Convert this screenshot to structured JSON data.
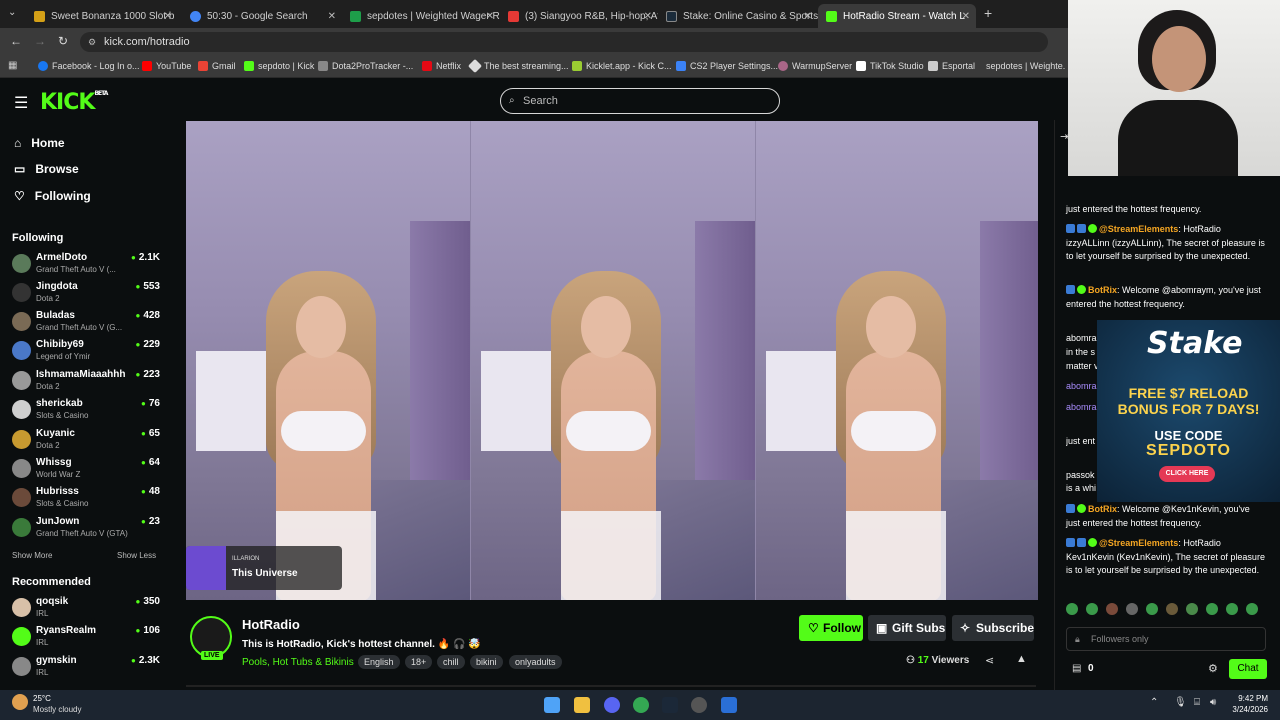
{
  "browser": {
    "tabs": [
      {
        "label": "Sweet Bonanza 1000 Slot b",
        "color": "#d4a017"
      },
      {
        "label": "50:30 - Google Search",
        "color": "#4285f4"
      },
      {
        "label": "sepdotes | Weighted Wager Ra",
        "color": "#1e9e4a"
      },
      {
        "label": "(3) Siangyoo R&B, Hip-hop, Afr",
        "color": "#e53935"
      },
      {
        "label": "Stake: Online Casino & Sports",
        "color": "#1b2b3a"
      },
      {
        "label": "HotRadio Stream - Watch L",
        "color": "#53fc18"
      }
    ],
    "url": "kick.com/hotradio",
    "bookmarks": [
      {
        "label": "Facebook - Log In o...",
        "color": "#1877f2"
      },
      {
        "label": "YouTube",
        "color": "#ff0000"
      },
      {
        "label": "Gmail",
        "color": "#ea4335"
      },
      {
        "label": "sepdoto | Kick",
        "color": "#53fc18"
      },
      {
        "label": "Dota2ProTracker -...",
        "color": "#888888"
      },
      {
        "label": "Netflix",
        "color": "#e50914"
      },
      {
        "label": "The best streaming...",
        "color": "#dddddd"
      },
      {
        "label": "Kicklet.app - Kick C...",
        "color": "#9acd32"
      },
      {
        "label": "CS2 Player Settings...",
        "color": "#3b82f6"
      },
      {
        "label": "WarmupServer",
        "color": "#aa6688"
      },
      {
        "label": "TikTok Studio",
        "color": "#ffffff"
      },
      {
        "label": "Esportal",
        "color": "#cccccc"
      },
      {
        "label": "sepdotes | Weighte...",
        "color": "#1e9e4a"
      }
    ]
  },
  "site": {
    "logo": "KICK",
    "logo_beta": "BETA",
    "search_placeholder": "Search",
    "nav": {
      "home": "Home",
      "browse": "Browse",
      "following": "Following"
    },
    "following_title": "Following",
    "following": [
      {
        "name": "ArmelDoto",
        "game": "Grand Theft Auto V (...",
        "viewers": "2.1K",
        "color": "#5a7a5a"
      },
      {
        "name": "Jingdota",
        "game": "Dota 2",
        "viewers": "553",
        "color": "#333333"
      },
      {
        "name": "Buladas",
        "game": "Grand Theft Auto V (G...",
        "viewers": "428",
        "color": "#7a6a55"
      },
      {
        "name": "Chibiby69",
        "game": "Legend of Ymir",
        "viewers": "229",
        "color": "#4a78c8"
      },
      {
        "name": "IshmamaMiaaahhh",
        "game": "Dota 2",
        "viewers": "223",
        "color": "#999999"
      },
      {
        "name": "sherickab",
        "game": "Slots & Casino",
        "viewers": "76",
        "color": "#cfcfcf"
      },
      {
        "name": "Kuyanic",
        "game": "Dota 2",
        "viewers": "65",
        "color": "#c89a30"
      },
      {
        "name": "Whissg",
        "game": "World War Z",
        "viewers": "64",
        "color": "#888888"
      },
      {
        "name": "Hubrisss",
        "game": "Slots & Casino",
        "viewers": "48",
        "color": "#6b4a3a"
      },
      {
        "name": "JunJown",
        "game": "Grand Theft Auto V (GTA)",
        "viewers": "23",
        "color": "#3a7a3a"
      }
    ],
    "show_more": "Show More",
    "show_less": "Show Less",
    "recommended_title": "Recommended",
    "recommended": [
      {
        "name": "qoqsik",
        "game": "IRL",
        "viewers": "350",
        "color": "#d8c0a8"
      },
      {
        "name": "RyansRealm",
        "game": "IRL",
        "viewers": "106",
        "color": "#53fc18"
      },
      {
        "name": "gymskin",
        "game": "IRL",
        "viewers": "2.3K",
        "color": "#888888"
      }
    ]
  },
  "player": {
    "music_artist": "ILLARION",
    "music_title": "This Universe"
  },
  "channel": {
    "name": "HotRadio",
    "live": "LIVE",
    "description": "This is HotRadio, Kick's hottest channel. 🔥 🎧 🤯",
    "category": "Pools, Hot Tubs & Bikinis",
    "tags": [
      "English",
      "18+",
      "chill",
      "bikini",
      "onlyadults"
    ],
    "follow": "Follow",
    "gift": "Gift Subs",
    "subscribe": "Subscribe",
    "viewers_count": "17",
    "viewers_label": "Viewers"
  },
  "chat": {
    "messages": [
      {
        "user": "",
        "text": "just entered the hottest frequency."
      },
      {
        "user": "@StreamElements",
        "text": "HotRadio izzyALLinn (izzyALLinn), The secret of pleasure is to let yourself be surprised by the unexpected.",
        "color": "#f5a623"
      },
      {
        "user": "BotRix",
        "text": "Welcome @abomraym, you've just entered the hottest frequency.",
        "color": "#f5a623"
      },
      {
        "user": "BotRix",
        "text": "Welcome @Kev1nKevin, you've just entered the hottest frequency.",
        "color": "#f5a623"
      },
      {
        "user": "@StreamElements",
        "text": "HotRadio Kev1nKevin (Kev1nKevin), The secret of pleasure is to let yourself be surprised by the unexpected.",
        "color": "#f5a623"
      }
    ],
    "partial": [
      "abomra",
      "in the s",
      "matter v",
      "abomra",
      "abomra",
      "just ent",
      "passok",
      "is a whi"
    ],
    "followers_only": "Followers only",
    "count": "0",
    "send": "Chat"
  },
  "ad": {
    "brand": "Stake",
    "headline1": "FREE $7 RELOAD",
    "headline2": "BONUS FOR 7 DAYS!",
    "code_label": "USE CODE",
    "code": "SEPDOTO",
    "cta": "CLICK HERE"
  },
  "taskbar": {
    "temp": "25°C",
    "weather": "Mostly cloudy",
    "time": "9:42 PM",
    "date": "3/24/2026"
  }
}
